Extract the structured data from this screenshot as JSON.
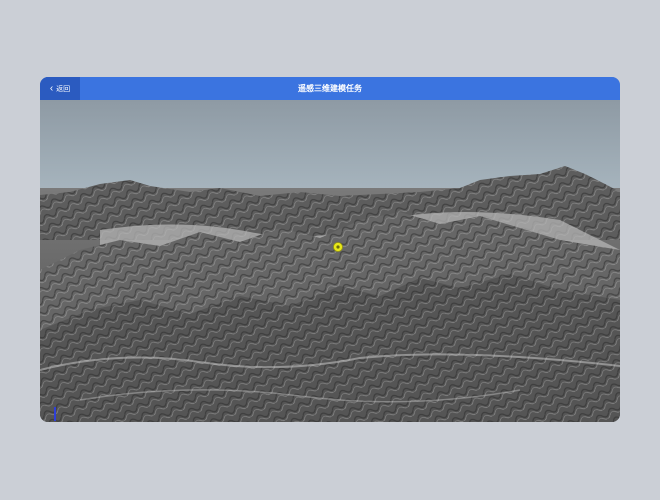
{
  "header": {
    "back_label": "返回",
    "title": "遥感三维建模任务"
  },
  "colors": {
    "titlebar": "#3b74e0",
    "back_button": "#2b5bc0",
    "marker": "#e8e81a"
  },
  "icons": {
    "back": "chevron-left-icon",
    "marker": "location-marker-icon"
  }
}
